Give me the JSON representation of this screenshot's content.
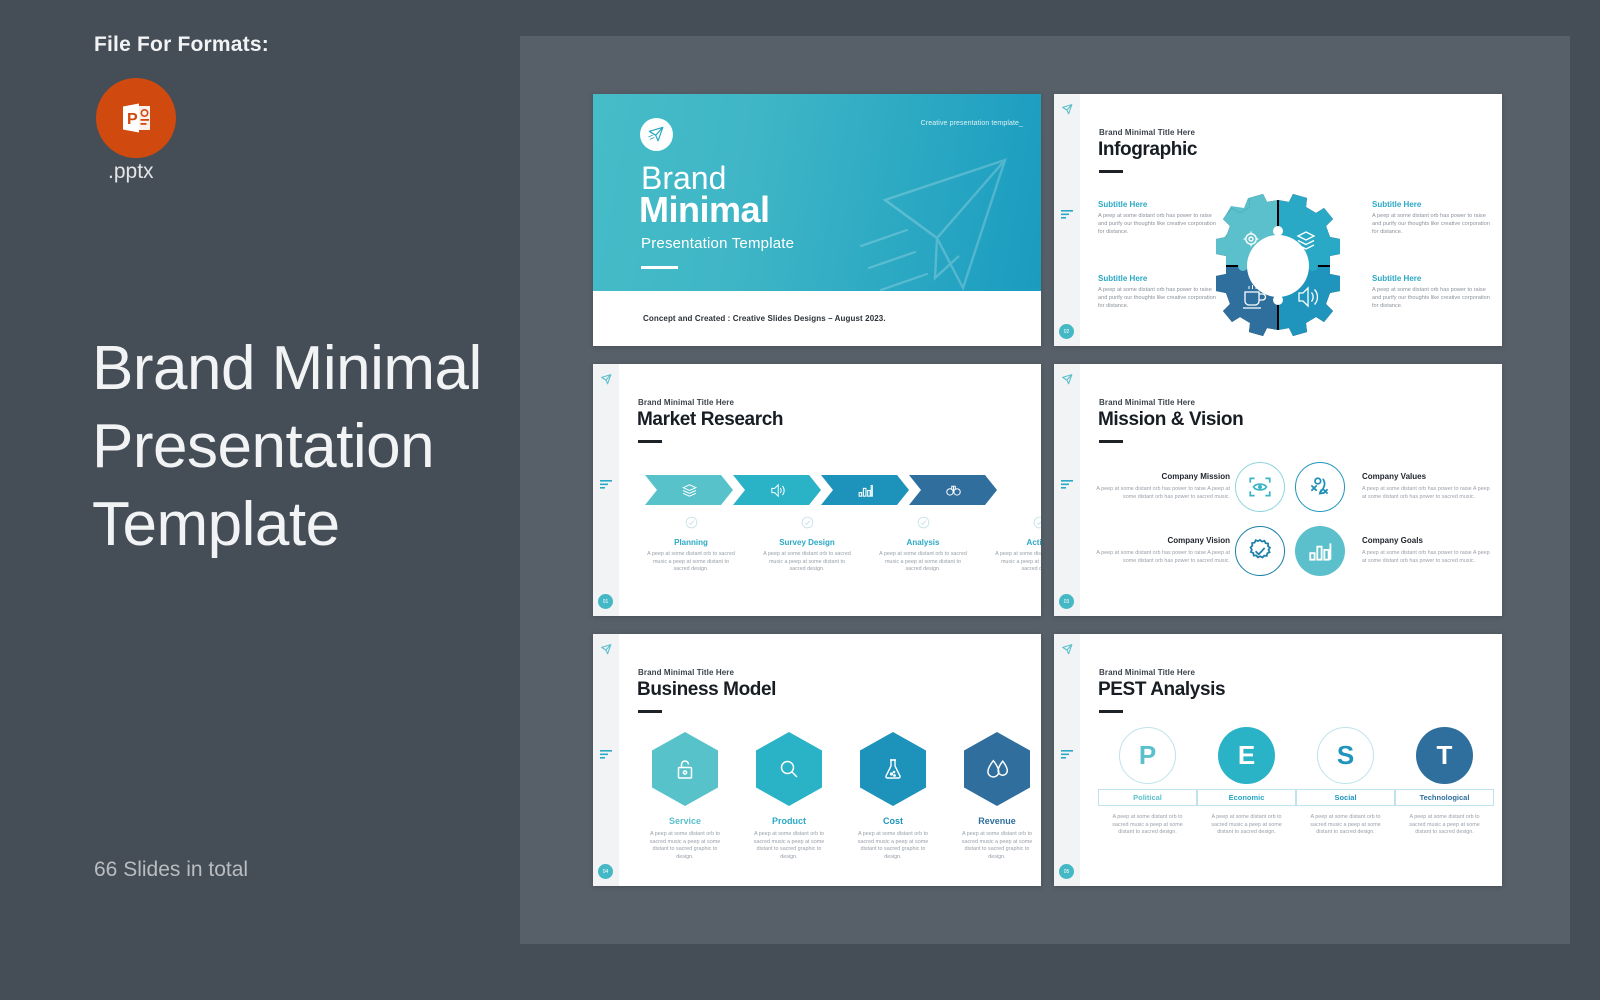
{
  "left": {
    "formats_label": "File For Formats:",
    "file_ext": ".pptx",
    "icon_name": "powerpoint-icon",
    "product_title": "Brand Minimal Presentation Template",
    "slides_total": "66 Slides in total"
  },
  "colors": {
    "background": "#454e57",
    "panel": "#575f69",
    "accent_light": "#5cc0cc",
    "accent": "#2aa9c6",
    "accent_mid": "#1f95bd",
    "accent_dark": "#2e6f9e",
    "powerpoint": "#d0490f",
    "heading": "#181d23",
    "body_text": "#99a0a8"
  },
  "slides": {
    "title_slide": {
      "tagline": "Creative presentation template_",
      "brand": "Brand",
      "headline": "Minimal",
      "subtitle": "Presentation Template",
      "footer": "Concept and Created : Creative Slides Designs – August 2023."
    },
    "infographic": {
      "eyebrow": "Brand Minimal Title Here",
      "title": "Infographic",
      "items": [
        {
          "subtitle": "Subtitle Here",
          "body": "A peep at some distant orb has power to raise and purify our thoughts like creative corporation for distance.",
          "icon": "gear-icon",
          "color": "#5cc0cc"
        },
        {
          "subtitle": "Subtitle Here",
          "body": "A peep at some distant orb has power to raise and purify our thoughts like creative corporation for distance.",
          "icon": "layers-icon",
          "color": "#2aa9c6"
        },
        {
          "subtitle": "Subtitle Here",
          "body": "A peep at some distant orb has power to raise and purify our thoughts like creative corporation for distance.",
          "icon": "coffee-icon",
          "color": "#2e6f9e"
        },
        {
          "subtitle": "Subtitle Here",
          "body": "A peep at some distant orb has power to raise and purify our thoughts like creative corporation for distance.",
          "icon": "speaker-icon",
          "color": "#1f95bd"
        }
      ]
    },
    "market_research": {
      "eyebrow": "Brand Minimal Title Here",
      "title": "Market Research",
      "steps": [
        {
          "name": "Planning",
          "icon": "layers-icon",
          "color": "#58c2cb",
          "body": "A peep at some distant orb to sacred music a peep at some distant to sacred design."
        },
        {
          "name": "Survey Design",
          "icon": "speaker-icon",
          "color": "#2ab2c6",
          "body": "A peep at some distant orb to sacred music a peep at some distant to sacred design."
        },
        {
          "name": "Analysis",
          "icon": "bar-chart-icon",
          "color": "#1d93bb",
          "body": "A peep at some distant orb to sacred music a peep at some distant to sacred design."
        },
        {
          "name": "Action",
          "icon": "binoculars-icon",
          "color": "#2f6e9d",
          "body": "A peep at some distant orb to sacred music a peep at some distant to sacred design."
        }
      ]
    },
    "mission_vision": {
      "eyebrow": "Brand Minimal Title Here",
      "title": "Mission & Vision",
      "items": [
        {
          "heading": "Company Mission",
          "icon": "eye-focus-icon",
          "body": "A peep at some distant orb has power to raise A peep at some distant orb has power to sacred music."
        },
        {
          "heading": "Company Values",
          "icon": "strategy-icon",
          "body": "A peep at some distant orb has power to raise A peep at some distant orb has power to sacred music."
        },
        {
          "heading": "Company Vision",
          "icon": "badge-check-icon",
          "body": "A peep at some distant orb has power to raise A peep at some distant orb has power to sacred music."
        },
        {
          "heading": "Company Goals",
          "icon": "bar-chart-icon",
          "body": "A peep at some distant orb has power to raise A peep at some distant orb has power to sacred music."
        }
      ]
    },
    "business_model": {
      "eyebrow": "Brand Minimal Title Here",
      "title": "Business Model",
      "items": [
        {
          "name": "Service",
          "icon": "unlock-icon",
          "color": "#58c2cb",
          "label_color": "#5cc0cc",
          "body": "A peep at some distant orb to sacred music a peep at some distant to sacred graphic to design."
        },
        {
          "name": "Product",
          "icon": "search-icon",
          "color": "#2ab2c6",
          "label_color": "#2aa9c6",
          "body": "A peep at some distant orb to sacred music a peep at some distant to sacred graphic to design."
        },
        {
          "name": "Cost",
          "icon": "flask-icon",
          "color": "#1d93bb",
          "label_color": "#1f95bd",
          "body": "A peep at some distant orb to sacred music a peep at some distant to sacred graphic to design."
        },
        {
          "name": "Revenue",
          "icon": "water-drop-icon",
          "color": "#2f6e9d",
          "label_color": "#2e6f9e",
          "body": "A peep at some distant orb to sacred music a peep at some distant to sacred graphic to design."
        }
      ]
    },
    "pest_analysis": {
      "eyebrow": "Brand Minimal Title Here",
      "title": "PEST Analysis",
      "items": [
        {
          "letter": "P",
          "label": "Political",
          "filled": false,
          "color": "#5cc0cc",
          "body": "A peep at some distant orb to sacred music a peep at some distant to sacred design."
        },
        {
          "letter": "E",
          "label": "Economic",
          "filled": true,
          "color": "#2ab2c6",
          "body": "A peep at some distant orb to sacred music a peep at some distant to sacred design."
        },
        {
          "letter": "S",
          "label": "Social",
          "filled": false,
          "color": "#1f95bd",
          "body": "A peep at some distant orb to sacred music a peep at some distant to sacred design."
        },
        {
          "letter": "T",
          "label": "Technological",
          "filled": true,
          "color": "#2e6f9e",
          "body": "A peep at some distant orb to sacred music a peep at some distant to sacred design."
        }
      ]
    }
  }
}
